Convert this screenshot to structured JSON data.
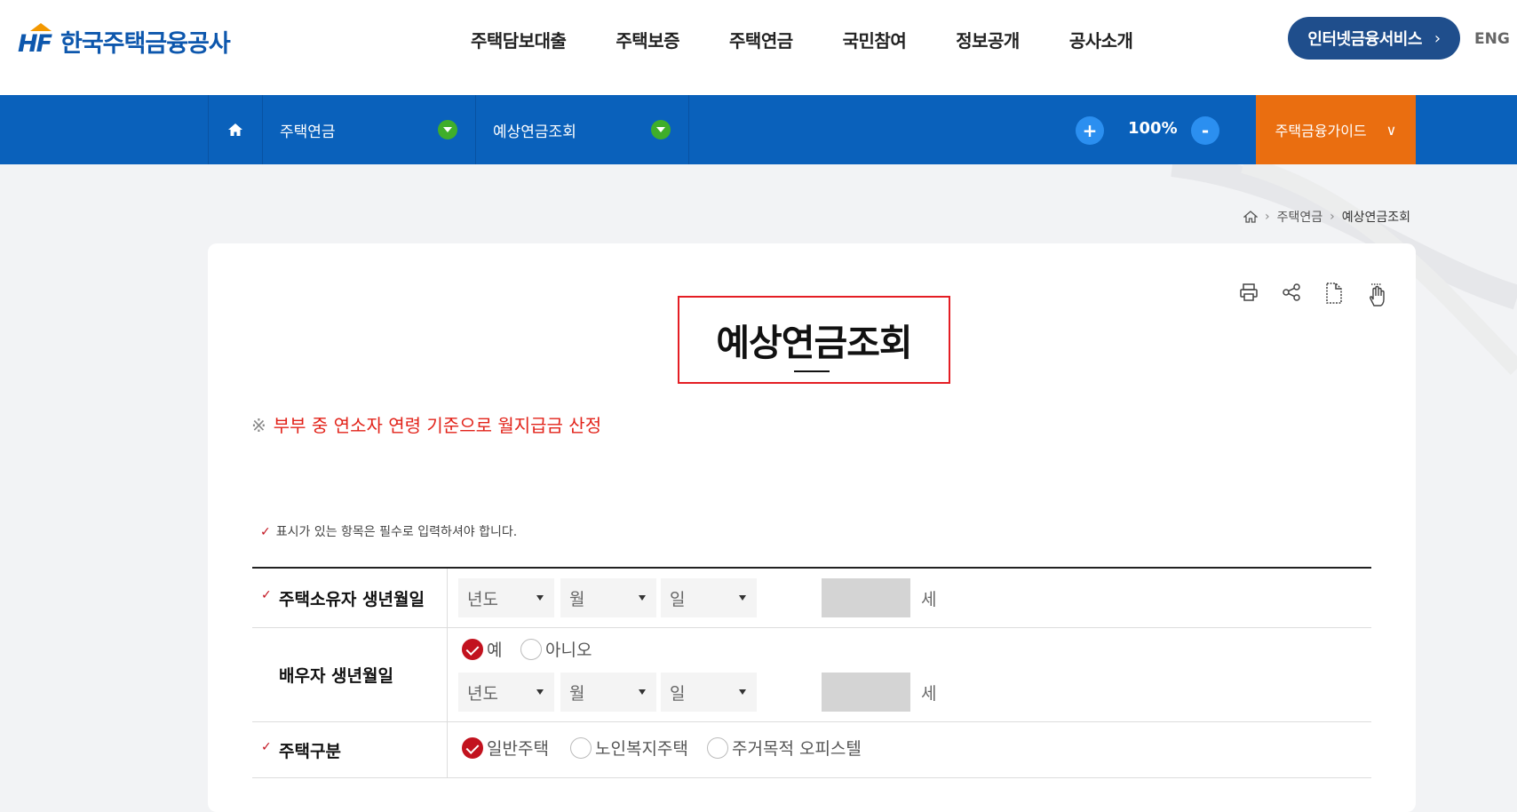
{
  "header": {
    "logo_mark": "HF",
    "logo_text": "한국주택금융공사",
    "nav": [
      "주택담보대출",
      "주택보증",
      "주택연금",
      "국민참여",
      "정보공개",
      "공사소개"
    ],
    "internet_service": "인터넷금융서비스",
    "eng": "ENG"
  },
  "subnav": {
    "menu1": "주택연금",
    "menu2": "예상연금조회",
    "zoom_in": "+",
    "zoom_value": "100%",
    "zoom_out": "-",
    "guide": "주택금융가이드"
  },
  "breadcrumb": {
    "level1": "주택연금",
    "current": "예상연금조회"
  },
  "page": {
    "title": "예상연금조회",
    "notice_mark": "※",
    "notice": "부부 중 연소자 연령 기준으로 월지급금 산정",
    "required_note": "표시가 있는 항목은 필수로 입력하셔야 합니다."
  },
  "form": {
    "owner_birth": {
      "label": "주택소유자 생년월일",
      "year": "년도",
      "month": "월",
      "day": "일",
      "age_unit": "세"
    },
    "spouse_birth": {
      "label": "배우자 생년월일",
      "yes": "예",
      "no": "아니오",
      "year": "년도",
      "month": "월",
      "day": "일",
      "age_unit": "세"
    },
    "house_type": {
      "label": "주택구분",
      "opt1": "일반주택",
      "opt2": "노인복지주택",
      "opt3": "주거목적 오피스텔"
    }
  },
  "colors": {
    "primary_blue": "#0a61bb",
    "guide_orange": "#ea6e10",
    "accent_red": "#c2121e",
    "notice_red": "#e2231a"
  }
}
